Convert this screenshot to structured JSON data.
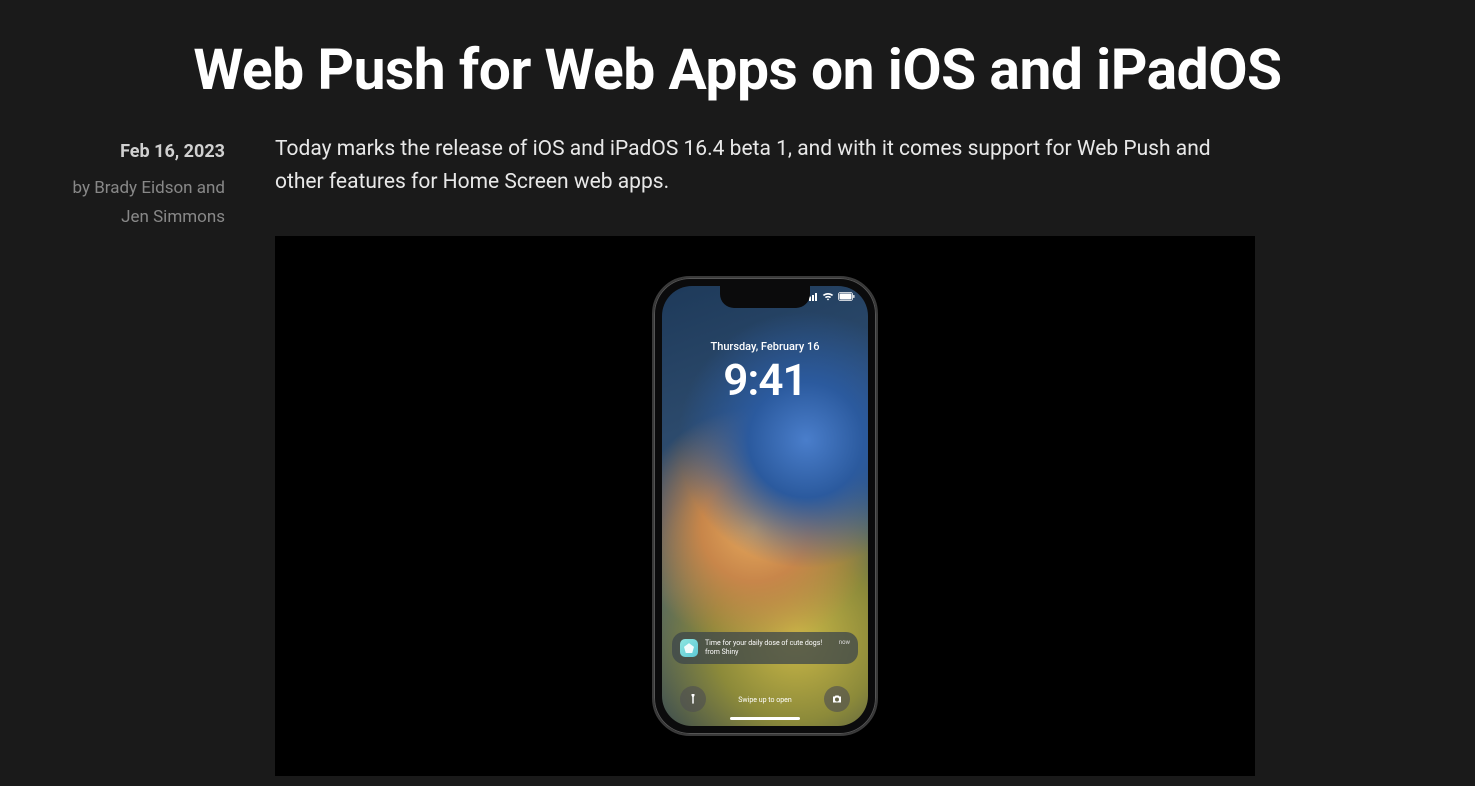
{
  "title": "Web Push for Web Apps on iOS and iPadOS",
  "meta": {
    "date": "Feb 16, 2023",
    "byline": "by Brady Eidson and Jen Simmons"
  },
  "intro": "Today marks the release of iOS and iPadOS 16.4 beta 1, and with it comes support for Web Push and other features for Home Screen web apps.",
  "phone": {
    "lock_date": "Thursday, February 16",
    "lock_time": "9:41",
    "notification": {
      "text": "Time for your daily dose of cute dogs! from Shiny",
      "when": "now"
    },
    "swipe_hint": "Swipe up to open",
    "status": {
      "signal": "▮▮▮▮",
      "wifi": "►",
      "battery": "▮▮"
    }
  }
}
